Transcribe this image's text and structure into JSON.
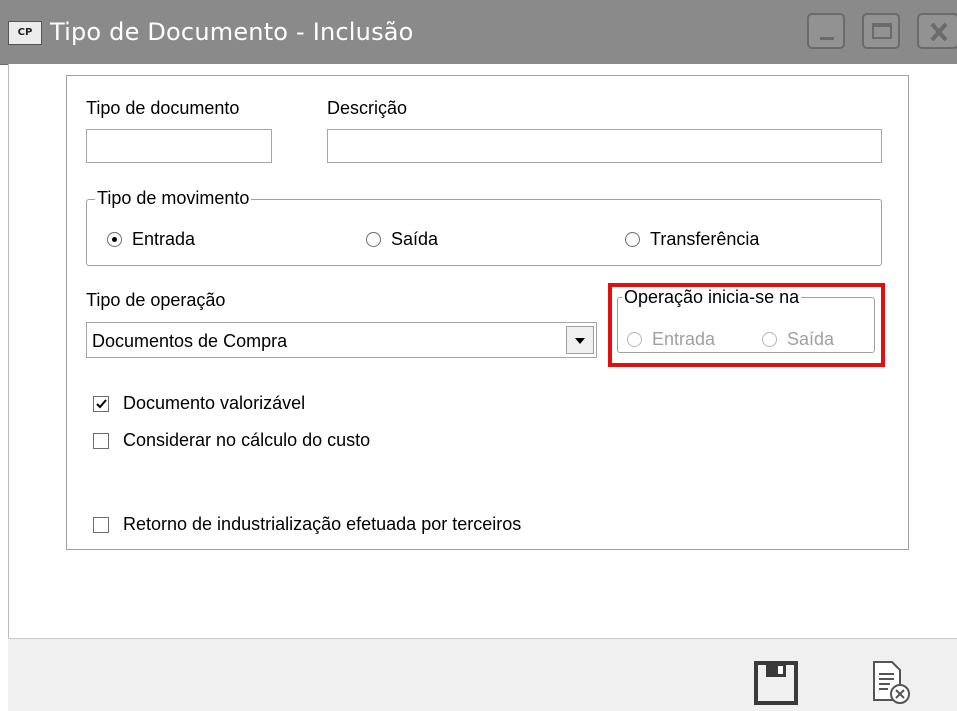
{
  "window": {
    "title": "Tipo de Documento - Inclusão",
    "app_icon": "CP",
    "controls": [
      "minimize-icon",
      "maximize-icon",
      "close-icon"
    ]
  },
  "form": {
    "tipo_documento": {
      "label": "Tipo de documento",
      "value": ""
    },
    "descricao": {
      "label": "Descrição",
      "value": ""
    },
    "tipo_movimento": {
      "legend": "Tipo de movimento",
      "options": [
        {
          "label": "Entrada",
          "checked": true
        },
        {
          "label": "Saída",
          "checked": false
        },
        {
          "label": "Transferência",
          "checked": false
        }
      ]
    },
    "tipo_operacao": {
      "label": "Tipo de operação",
      "value": "Documentos de Compra"
    },
    "operacao_inicia": {
      "legend": "Operação inicia-se na",
      "options": [
        {
          "label": "Entrada",
          "enabled": false
        },
        {
          "label": "Saída",
          "enabled": false
        }
      ],
      "highlight_color": "#e20f0f"
    },
    "checkboxes": [
      {
        "label": "Documento valorizável",
        "checked": true
      },
      {
        "label": "Considerar no cálculo do custo",
        "checked": false
      },
      {
        "label": "Retorno de industrialização efetuada por terceiros",
        "checked": false
      }
    ]
  },
  "toolbar": {
    "save_icon": "floppy-disk-icon",
    "cancel_icon": "document-cancel-icon"
  }
}
